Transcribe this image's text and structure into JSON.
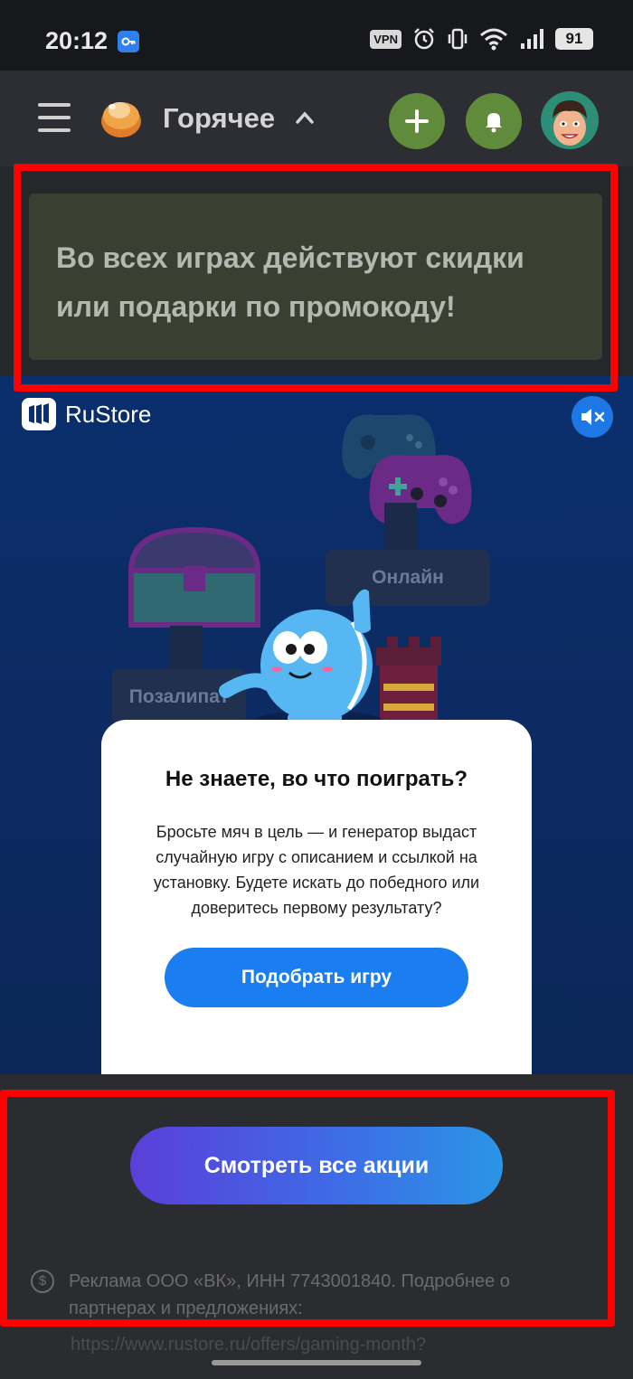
{
  "status_bar": {
    "time": "20:12",
    "vpn_label": "VPN",
    "battery": "91",
    "icons": [
      "vpn-key-icon",
      "alarm-icon",
      "vibrate-icon",
      "wifi-icon",
      "signal-icon"
    ]
  },
  "header": {
    "title": "Горячее",
    "icons": [
      "menu-icon",
      "logo-icon",
      "chevron-up-icon",
      "plus-icon",
      "bell-icon",
      "avatar"
    ],
    "accent_color": "#5f8b3b"
  },
  "promo": {
    "text": "Во всех играх действуют скидки или подарки по промокоду!"
  },
  "ad": {
    "brand": "RuStore",
    "sign_online": "Онлайн",
    "sign_pozalipat": "Позалипат",
    "card_title": "Не знаете, во что поиграть?",
    "card_body": "Бросьте мяч в цель — и генератор выдаст случайную игру с описанием и ссылкой на установку. Будете искать до победного или доверитесь первому результату?",
    "card_button": "Подобрать игру",
    "button_color": "#1a7ef0"
  },
  "footer": {
    "all_deals_button": "Смотреть все акции",
    "ad_disclaimer": "Реклама ООО «ВК», ИНН 7743001840. Подробнее о партнерах и предложениях:",
    "ad_link": "https://www.rustore.ru/offers/gaming-month?"
  },
  "annotation_color": "#ff0000"
}
